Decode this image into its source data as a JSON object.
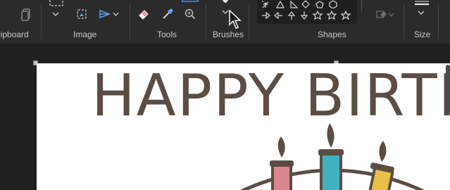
{
  "ribbon": {
    "groups": {
      "clipboard": "lipboard",
      "image": "Image",
      "tools": "Tools",
      "brushes": "Brushes",
      "shapes": "Shapes",
      "size": "Size"
    }
  },
  "canvas": {
    "headline": "HAPPY BIRTH"
  },
  "colors": {
    "ribbon": "#2b2b2b",
    "background": "#202020",
    "headline": "#5b4d44",
    "candle_pink": "#d9868f",
    "candle_teal": "#3fb3bd",
    "candle_yellow": "#e7c04a"
  }
}
